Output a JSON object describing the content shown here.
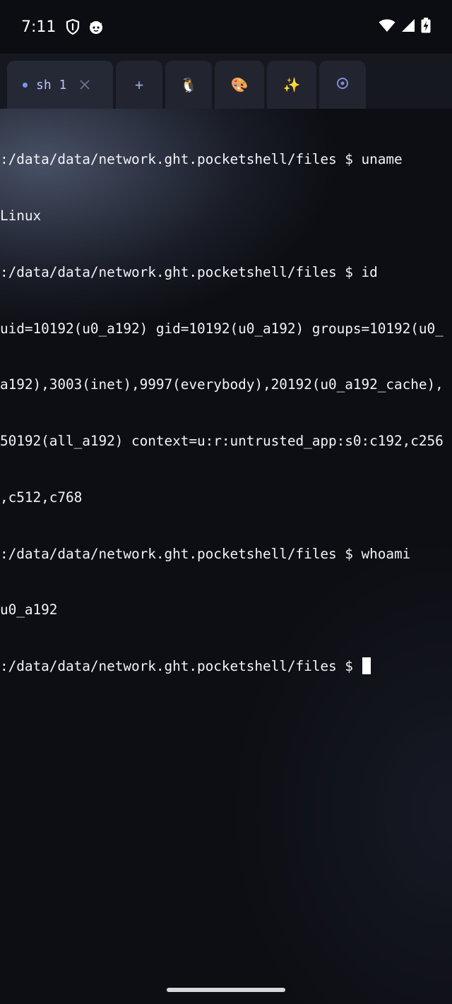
{
  "status_bar": {
    "time": "7:11",
    "left_icons": [
      "shield-icon",
      "cat-face-icon"
    ],
    "right_icons": [
      "wifi-icon",
      "cellular-signal-icon",
      "battery-charging-icon"
    ]
  },
  "tabs": {
    "active": {
      "label": "sh 1",
      "close_icon": "close-icon"
    },
    "new_tab": "+",
    "icons": [
      "🐧",
      "🎨",
      "✨"
    ],
    "settings_icon": "gear-icon"
  },
  "terminal": {
    "lines": [
      ":/data/data/network.ght.pocketshell/files $ uname",
      "Linux",
      ":/data/data/network.ght.pocketshell/files $ id",
      "uid=10192(u0_a192) gid=10192(u0_a192) groups=10192(u0_",
      "a192),3003(inet),9997(everybody),20192(u0_a192_cache),",
      "50192(all_a192) context=u:r:untrusted_app:s0:c192,c256",
      ",c512,c768",
      ":/data/data/network.ght.pocketshell/files $ whoami",
      "u0_a192"
    ],
    "prompt": ":/data/data/network.ght.pocketshell/files $ "
  },
  "colors": {
    "accent": "#7e93f5",
    "background": "#0d0e13",
    "tab_background": "#22252f",
    "text": "#f2f3f7"
  }
}
